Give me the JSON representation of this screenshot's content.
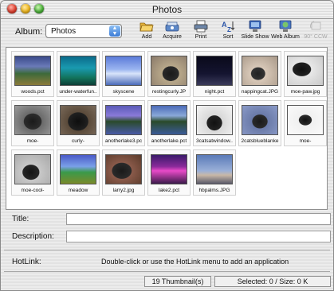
{
  "window": {
    "title": "Photos"
  },
  "toolbar": {
    "album_label": "Album:",
    "album_value": "Photos",
    "buttons": [
      {
        "label": "Add",
        "icon": "folder-open-icon"
      },
      {
        "label": "Acquire",
        "icon": "scanner-icon"
      },
      {
        "label": "Print",
        "icon": "printer-icon"
      },
      {
        "label": "Sort",
        "icon": "sort-icon"
      },
      {
        "label": "Slide Show",
        "icon": "monitor-icon"
      },
      {
        "label": "Web Album",
        "icon": "web-album-icon"
      },
      {
        "label": "90° CCW",
        "icon": "rotate-icon",
        "disabled": true
      }
    ]
  },
  "thumbnails": [
    {
      "caption": "woods.pct",
      "scene": "woods"
    },
    {
      "caption": "under-waterfun..",
      "scene": "underwater"
    },
    {
      "caption": "skyscene",
      "scene": "sky"
    },
    {
      "caption": "restingcurly.JP",
      "scene": "cat-dark"
    },
    {
      "caption": "night.pct",
      "scene": "night"
    },
    {
      "caption": "nappingcat.JPG",
      "scene": "cat-light"
    },
    {
      "caption": "moe-paw.jpg",
      "scene": "cat-bw"
    },
    {
      "caption": "moe-",
      "scene": "cat-bw2"
    },
    {
      "caption": "curly-",
      "scene": "cat-dark2"
    },
    {
      "caption": "anotherlake3.pc",
      "scene": "lake"
    },
    {
      "caption": "anotherlake.pct",
      "scene": "lake2"
    },
    {
      "caption": "3catsatwindow..",
      "scene": "cat-window"
    },
    {
      "caption": "2catsblueblanke",
      "scene": "cat-blue"
    },
    {
      "caption": "moe-",
      "scene": "cat-white"
    },
    {
      "caption": "moe-cool-",
      "scene": "cat-cool"
    },
    {
      "caption": "meadow",
      "scene": "meadow"
    },
    {
      "caption": "larry2.jpg",
      "scene": "larry"
    },
    {
      "caption": "lake2.pct",
      "scene": "sunset"
    },
    {
      "caption": "hbpalms.JPG",
      "scene": "palms"
    }
  ],
  "fields": {
    "title_label": "Title:",
    "title_value": "",
    "description_label": "Description:",
    "description_value": ""
  },
  "hotlink": {
    "label": "HotLink:",
    "text": "Double-click or use the HotLink menu to add an application"
  },
  "status": {
    "count": "19 Thumbnail(s)",
    "selection": "Selected: 0 / Size: 0 K"
  }
}
